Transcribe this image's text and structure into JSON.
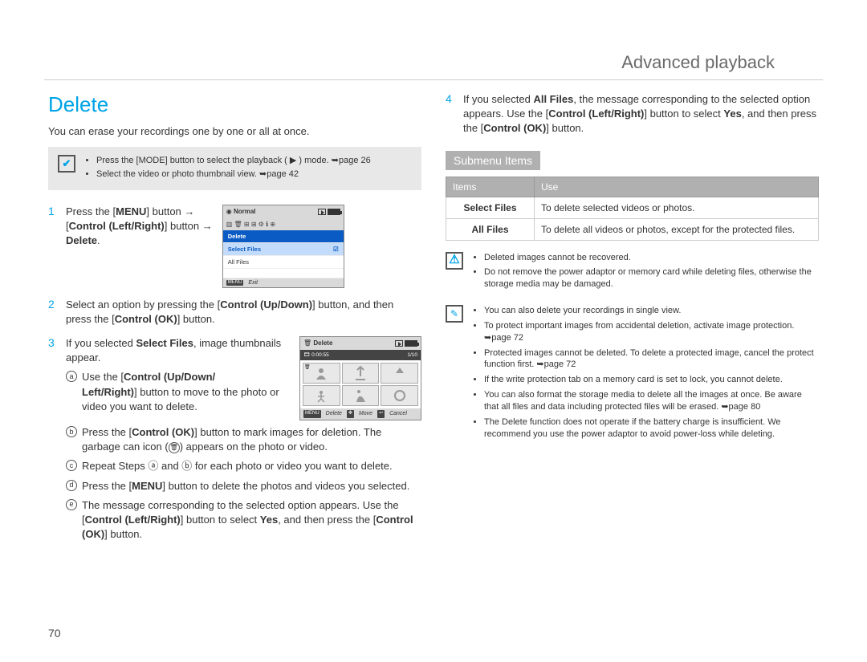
{
  "header": {
    "title": "Advanced playback"
  },
  "page_number": "70",
  "left": {
    "section_title": "Delete",
    "intro": "You can erase your recordings one by one or all at once.",
    "prebox": {
      "items": [
        "Press the [MODE] button to select the playback ( ▶ ) mode. ➥page 26",
        "Select the video or photo thumbnail view. ➥page 42"
      ]
    },
    "steps": {
      "s1": {
        "num": "1",
        "text_a": "Press the [",
        "b1": "MENU",
        "text_b": "] button ",
        "arrow1": "→",
        "text_c": " [",
        "b2": "Control (Left/Right)",
        "text_d": "] button ",
        "arrow2": "→",
        "text_e": " ",
        "b3": "Delete",
        "text_f": "."
      },
      "s2": {
        "num": "2",
        "text_a": "Select an option by pressing the [",
        "b1": "Control (Up/Down)",
        "text_b": "] button, and then press the [",
        "b2": "Control (OK)",
        "text_c": "] button."
      },
      "s3": {
        "num": "3",
        "text_a": "If you selected ",
        "b1": "Select Files",
        "text_b": ", image thumbnails appear.",
        "sub": {
          "a": {
            "mark": "a",
            "text": "Use the [Control (Up/Down/Left/Right)] button to move to the photo or video you want to delete."
          },
          "b": {
            "mark": "b",
            "text": "Press the [Control (OK)] button to mark images for deletion. The garbage can icon (🗑) appears on the photo or video."
          },
          "c": {
            "mark": "c",
            "text": "Repeat Steps ⓐ and ⓑ for each photo or video you want to delete."
          },
          "d": {
            "mark": "d",
            "text": "Press the [MENU] button to delete the photos and videos you selected."
          },
          "e": {
            "mark": "e",
            "text": "The message corresponding to the selected option appears. Use the [Control (Left/Right)] button to select Yes, and then press the [Control (OK)] button."
          }
        }
      }
    },
    "screen1": {
      "title": "Normal",
      "row_delete": "Delete",
      "row_select": "Select Files",
      "row_all": "All Files",
      "footer_menu": "MENU",
      "footer_exit": "Exit"
    },
    "screen2": {
      "title": "Delete",
      "time": "0:00:55",
      "count": "1/10",
      "footer_menu": "MENU",
      "footer_delete": "Delete",
      "footer_move": "Move",
      "footer_cancel": "Cancel"
    }
  },
  "right": {
    "step4": {
      "num": "4",
      "text_a": "If you selected ",
      "b1": "All Files",
      "text_b": ", the message corresponding to the selected option appears. Use the [",
      "b2": "Control (Left/Right)",
      "text_c": "] button to select ",
      "b3": "Yes",
      "text_d": ", and then press the [",
      "b4": "Control (OK)",
      "text_e": "] button."
    },
    "submenu_label": "Submenu Items",
    "table": {
      "h1": "Items",
      "h2": "Use",
      "r1c1": "Select Files",
      "r1c2": "To delete selected videos or photos.",
      "r2c1": "All Files",
      "r2c2": "To delete all videos or photos, except for the protected files."
    },
    "warn": {
      "items": [
        "Deleted images cannot be recovered.",
        "Do not remove the power adaptor or memory card while deleting files, otherwise the storage media may be damaged."
      ]
    },
    "tips": {
      "items": [
        "You can also delete your recordings in single view.",
        "To protect important images from accidental deletion, activate image protection. ➥page 72",
        "Protected images cannot be deleted. To delete a protected image, cancel the protect function first. ➥page 72",
        "If the write protection tab on a memory card is set to lock, you cannot delete.",
        "You can also format the storage media to delete all the images at once. Be aware that all files and data including protected files will be erased. ➥page 80",
        "The Delete function does not operate if the battery charge is insufficient. We recommend you use the power adaptor to avoid power-loss while deleting."
      ]
    }
  }
}
